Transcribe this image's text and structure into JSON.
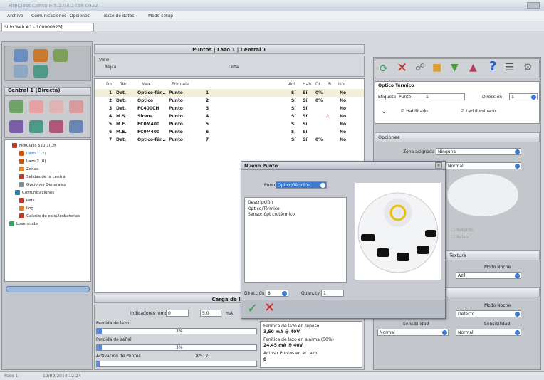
{
  "app": {
    "title": "FireClass Console 5.2.03.2458 0922"
  },
  "menu": [
    "Archivo",
    "Comunicaciones",
    "Opciones",
    "Base de datos",
    "Modo setup"
  ],
  "doc_tab": "Sitio Web #1 - 100000823]",
  "left": {
    "central_label": "Central 1 (Directa)",
    "tree": [
      {
        "label": "FireClass 520 1(Dn",
        "color": "#c0392b"
      },
      {
        "label": "Lazo 1 (7)",
        "color": "#d35400"
      },
      {
        "label": "Lazo 2 (0)",
        "color": "#d35400"
      },
      {
        "label": "Zonas",
        "color": "#e67e22"
      },
      {
        "label": "Salidas de la central",
        "color": "#c0392b"
      },
      {
        "label": "Opciones Generales",
        "color": "#7f8c8d"
      },
      {
        "label": "Comunicaciones",
        "color": "#2980b9"
      },
      {
        "label": "Pets",
        "color": "#c0392b"
      },
      {
        "label": "Log",
        "color": "#e67e22"
      },
      {
        "label": "Calculo de calculosbaterias",
        "color": "#c0392b"
      },
      {
        "label": "Lose mode",
        "color": "#27ae60"
      }
    ]
  },
  "center": {
    "header": "Puntos | Lazo 1 | Central 1",
    "view_label": "View",
    "view_grid": "Rejila",
    "view_list": "Lista",
    "columns": [
      "Dir.",
      "Tec.",
      "Mex.",
      "Etiqueta",
      "",
      "Act.",
      "Hab.",
      "DL.",
      "B.",
      "Isol."
    ],
    "rows": [
      {
        "dir": "1",
        "tec": "Det.",
        "mod": "Optico-Tér...",
        "etq": "Punto",
        "n": "1",
        "act": "Sí",
        "hab": "Sí",
        "dl": "0%",
        "b": "",
        "iso": "No"
      },
      {
        "dir": "2",
        "tec": "Det.",
        "mod": "Optico",
        "etq": "Punto",
        "n": "2",
        "act": "Sí",
        "hab": "Sí",
        "dl": "0%",
        "b": "",
        "iso": "No"
      },
      {
        "dir": "3",
        "tec": "Det.",
        "mod": "FC400CH",
        "etq": "Punto",
        "n": "3",
        "act": "Sí",
        "hab": "Sí",
        "dl": "",
        "b": "",
        "iso": "No"
      },
      {
        "dir": "4",
        "tec": "M.S.",
        "mod": "Sirena",
        "etq": "Punto",
        "n": "4",
        "act": "Sí",
        "hab": "Sí",
        "dl": "",
        "b": "bell",
        "iso": "No"
      },
      {
        "dir": "5",
        "tec": "M.E.",
        "mod": "FC0M400",
        "etq": "Punto",
        "n": "5",
        "act": "Sí",
        "hab": "Sí",
        "dl": "",
        "b": "",
        "iso": "No"
      },
      {
        "dir": "6",
        "tec": "M.E.",
        "mod": "FC0M400",
        "etq": "Punto",
        "n": "6",
        "act": "Sí",
        "hab": "Sí",
        "dl": "",
        "b": "",
        "iso": "No"
      },
      {
        "dir": "7",
        "tec": "Det.",
        "mod": "Optico-Tér...",
        "etq": "Punto",
        "n": "7",
        "act": "Sí",
        "hab": "Sí",
        "dl": "0%",
        "b": "",
        "iso": "No"
      }
    ],
    "carga_label": "Carga de laz",
    "indicators_label": "Indicadores remotos",
    "indicators_value": "0",
    "current_value": "5.0",
    "current_unit": "mA",
    "perdida_lazo": "Perdida de lazo",
    "perdida_lazo_val": "3%",
    "perdida_senal": "Perdida de señal",
    "perdida_senal_val": "3%",
    "activacion": "Activación de Puntos",
    "activacion_val": "8/512",
    "reposo_label": "Fenitica de lazo en reposo",
    "reposo_val": "3,50 mA @ 40V",
    "alarma_label": "Fenitica de lazo en alarma (50%)",
    "alarma_val": "24,45 mA @ 40V",
    "activar_label": "Activar Puntos en el Lazo",
    "activar_val": "8"
  },
  "dialog": {
    "title": "Nuevo Punto",
    "punto_label": "Punto",
    "punto_value": "Optico/Térmico",
    "desc_label": "Descripción",
    "desc_line1": "Optico/Térmico",
    "desc_line2": "Sensor ópt co/térmico",
    "direccion_label": "Dirección",
    "direccion_value": "8",
    "quantity_label": "Quantity",
    "quantity_value": "1"
  },
  "right": {
    "section_title": "Optico Térmico",
    "etiqueta_label": "Etiqueta",
    "etiqueta_value": "Punto",
    "etiqueta_num": "1",
    "direccion_label": "Dirección",
    "direccion_value": "1",
    "habilitado": "Habilitado",
    "led": "Led iluminado",
    "opciones": "Opciones",
    "zona_label": "Zona asignada",
    "zona_value": "Ninguna",
    "normal": "Normal",
    "retardo": "Retardo",
    "aviso": "Aviso",
    "textura": "Textura",
    "modo_noche1": "Modo Noche",
    "modo_noche1_val": "Azil",
    "modo_noche2": "Modo Noche",
    "modo_noche2_val": "Defecto",
    "sens_label1": "Sensibilidad",
    "sens_val1": "Normal",
    "sens_label2": "Sensibilidad",
    "sens_val2": "Normal"
  },
  "status": {
    "left": "Paso 1",
    "right": "19/09/2014 12:24"
  }
}
